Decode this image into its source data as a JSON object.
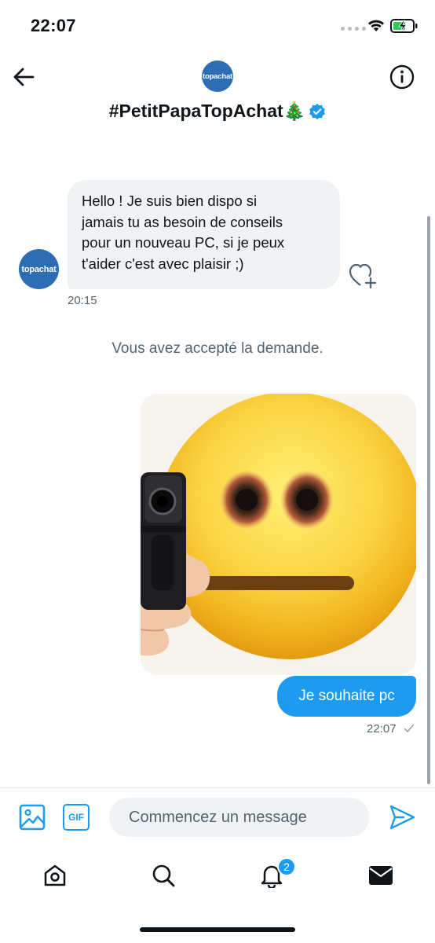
{
  "status_bar": {
    "time": "22:07",
    "icons": [
      "signal-icon",
      "wifi-icon",
      "battery-charging-icon"
    ]
  },
  "header": {
    "back_icon": "arrow-left-icon",
    "avatar_text": "topachat",
    "title": "#PetitPapaTopAchat🎄",
    "verified_icon": "verified-badge-icon",
    "info_icon": "info-icon"
  },
  "conversation": {
    "incoming": {
      "avatar_text": "topachat",
      "text": "Hello ! Je suis bien dispo si\njamais tu as besoin de conseils\npour un nouveau PC, si je peux\nt'aider c'est avec plaisir ;)",
      "time": "20:15",
      "reaction_icon": "heart-plus-icon"
    },
    "system_note": "Vous avez accepté la demande.",
    "outgoing": {
      "image": "emoji-with-pistol-image",
      "text": "Je souhaite pc",
      "time": "22:07",
      "status_icon": "sent-check-icon"
    }
  },
  "composer": {
    "image_icon": "image-icon",
    "gif_label": "GIF",
    "placeholder": "Commencez un message",
    "send_icon": "send-icon"
  },
  "bottom_nav": {
    "items": [
      "home-icon",
      "search-icon",
      "notifications-icon",
      "messages-icon"
    ],
    "notification_count": "2"
  },
  "colors": {
    "accent": "#1d9bf0",
    "brand_avatar": "#2d6db4",
    "bubble_incoming": "#eff3f4",
    "secondary_text": "#536471"
  }
}
